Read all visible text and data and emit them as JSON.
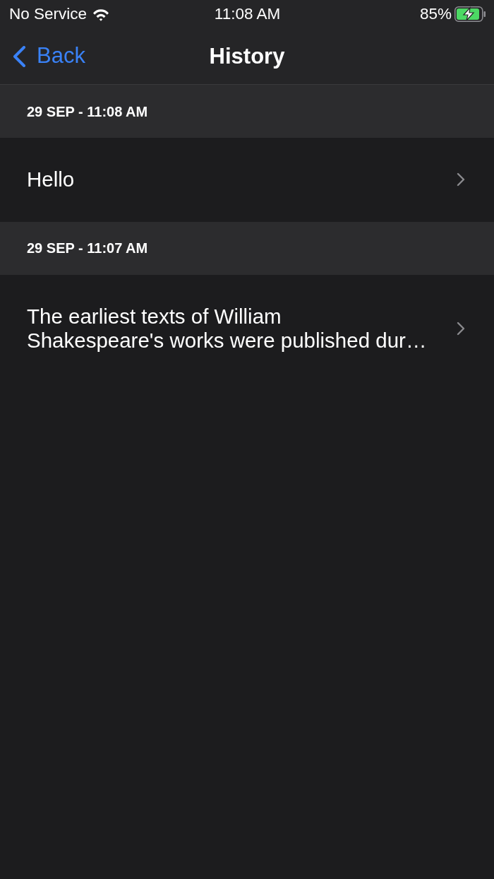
{
  "status_bar": {
    "carrier": "No Service",
    "time": "11:08 AM",
    "battery_percent": "85%"
  },
  "nav_bar": {
    "back_label": "Back",
    "title": "History"
  },
  "sections": [
    {
      "header": "29 SEP - 11:08 AM",
      "items": [
        {
          "lines": [
            "Hello"
          ]
        }
      ]
    },
    {
      "header": "29 SEP - 11:07 AM",
      "items": [
        {
          "lines": [
            "The earliest texts of William",
            "Shakespeare's works were published dur…"
          ]
        }
      ]
    }
  ]
}
